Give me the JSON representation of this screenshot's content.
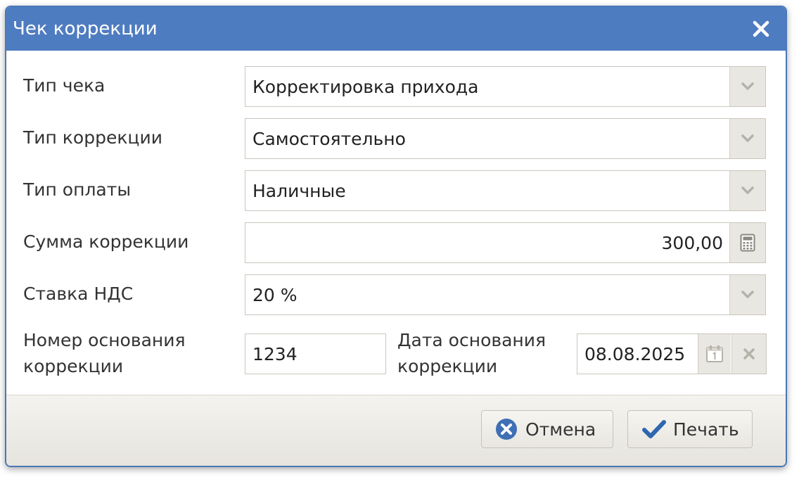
{
  "dialog": {
    "title": "Чек коррекции",
    "close_icon": "close-icon"
  },
  "form": {
    "receipt_type": {
      "label": "Тип чека",
      "value": "Корректировка прихода",
      "icon": "chevron-down-icon"
    },
    "correction_type": {
      "label": "Тип коррекции",
      "value": "Самостоятельно",
      "icon": "chevron-down-icon"
    },
    "payment_type": {
      "label": "Тип оплаты",
      "value": "Наличные",
      "icon": "chevron-down-icon"
    },
    "correction_amount": {
      "label": "Сумма коррекции",
      "value": "300,00",
      "icon": "calculator-icon"
    },
    "vat_rate": {
      "label": "Ставка НДС",
      "value": "20 %",
      "icon": "chevron-down-icon"
    },
    "basis_number": {
      "label_line1": "Номер основания",
      "label_line2": "коррекции",
      "value": "1234"
    },
    "basis_date": {
      "label_line1": "Дата основания",
      "label_line2": "коррекции",
      "value": "08.08.2025",
      "calendar_icon": "calendar-icon",
      "clear_icon": "clear-icon"
    }
  },
  "footer": {
    "cancel_label": "Отмена",
    "print_label": "Печать"
  },
  "colors": {
    "titlebar": "#4e7cc1",
    "cancel_icon": "#3f6fb5",
    "print_icon": "#2f66b0"
  }
}
